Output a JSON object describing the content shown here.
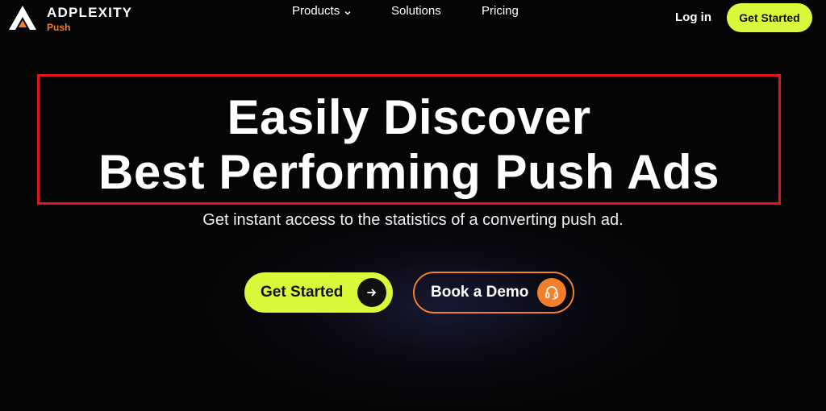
{
  "brand": {
    "name": "ADPLEXITY",
    "product": "Push",
    "accent_color": "#f37f2a"
  },
  "nav": {
    "items": [
      {
        "label": "Products",
        "has_dropdown": true
      },
      {
        "label": "Solutions"
      },
      {
        "label": "Pricing"
      }
    ],
    "login_label": "Log in",
    "cta_label": "Get Started"
  },
  "hero": {
    "title_line1": "Easily Discover",
    "title_line2": "Best Performing Push Ads",
    "subtitle": "Get instant access to the statistics of a converting push ad.",
    "highlight_color": "#e01717"
  },
  "cta": {
    "primary_label": "Get Started",
    "primary_icon": "arrow-right-icon",
    "primary_color": "#d9f93a",
    "secondary_label": "Book a Demo",
    "secondary_icon": "headset-icon"
  }
}
